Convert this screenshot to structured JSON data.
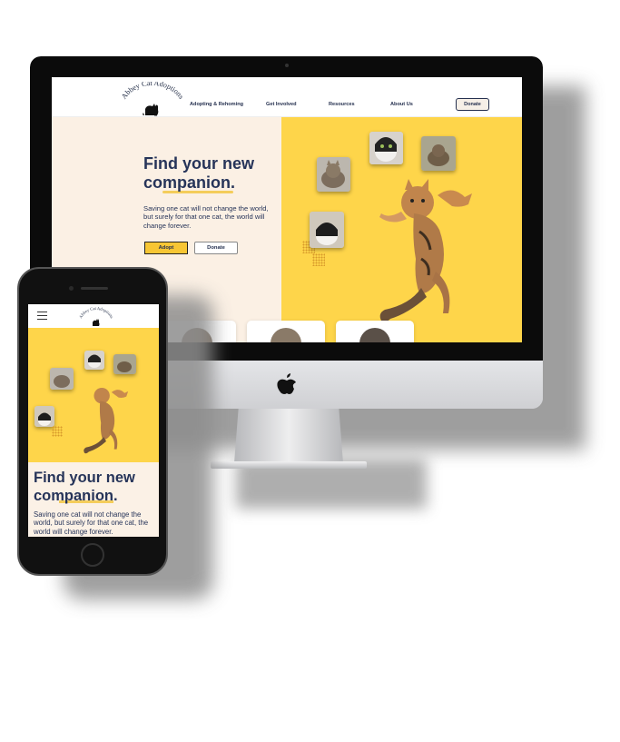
{
  "desktop": {
    "logo_text": "Abbey Cat Adoptions",
    "nav": {
      "items": [
        "Adopting & Rehoming",
        "Get Involved",
        "Resources",
        "About Us"
      ],
      "donate_label": "Donate"
    },
    "hero": {
      "title": "Find your new companion.",
      "text": "Saving one cat will not change the world, but surely for that one cat, the world will change forever.",
      "adopt_label": "Adopt",
      "donate_label": "Donate"
    }
  },
  "phone": {
    "logo_text": "Abbey Cat Adoptions",
    "hero": {
      "title": "Find your new companion.",
      "text": "Saving one cat will not change the world, but surely for that one cat, the world will change forever."
    }
  },
  "colors": {
    "accent_yellow": "#fed54a",
    "navy": "#263459",
    "cream": "#fbf0e4"
  }
}
